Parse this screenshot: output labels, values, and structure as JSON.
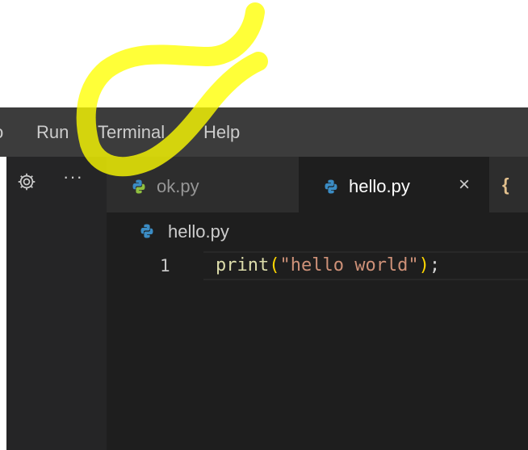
{
  "menubar": {
    "items": [
      {
        "label": "o"
      },
      {
        "label": "Run"
      },
      {
        "label": "Terminal"
      },
      {
        "label": "Help"
      }
    ]
  },
  "sidebar": {
    "gear_icon": "gear-icon",
    "more_label": "···"
  },
  "tabs": [
    {
      "label": "ok.py",
      "icon": "python-icon",
      "active": false
    },
    {
      "label": "hello.py",
      "icon": "python-icon",
      "active": true,
      "close": "×"
    },
    {
      "label": "{",
      "icon": "json-icon",
      "active": false
    }
  ],
  "breadcrumb": {
    "icon": "python-icon",
    "label": "hello.py"
  },
  "editor": {
    "lines": [
      {
        "number": "1",
        "tokens": {
          "fn": "print",
          "open": "(",
          "str": "\"hello world\"",
          "close": ")",
          "semi": ";"
        }
      }
    ]
  },
  "colors": {
    "menubar_bg": "#3c3c3c",
    "editor_bg": "#1e1e1e",
    "highlight": "#ffff00",
    "python_blue": "#3b8cc4",
    "python_green": "#8fbf3f"
  }
}
